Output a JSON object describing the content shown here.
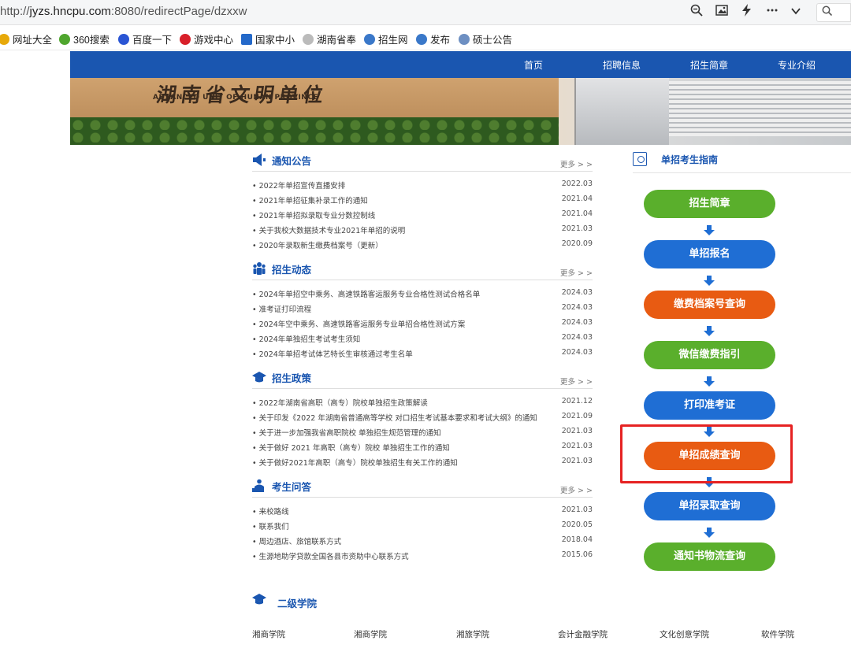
{
  "browser": {
    "url_prefix": "http://",
    "url_domain": "jyzs.hncpu.com",
    "url_rest": ":8080/redirectPage/dzxxw",
    "bookmarks": [
      "网址大全",
      "360搜索",
      "百度一下",
      "游戏中心",
      "国家中小",
      "湖南省奉",
      "招生网",
      "发布",
      "硕士公告"
    ]
  },
  "nav": [
    "首页",
    "招聘信息",
    "招生简章",
    "专业介绍"
  ],
  "banner": {
    "title": "湖南省文明单位",
    "subtitle": "ADVANCED UNIT OF HUNAN PROVINCE"
  },
  "more_label": "更多 > >",
  "sections": [
    {
      "title": "通知公告",
      "items": [
        {
          "text": "• 2022年单招宣传直播安排",
          "date": "2022.03"
        },
        {
          "text": "• 2021年单招征集补录工作的通知",
          "date": "2021.04"
        },
        {
          "text": "• 2021年单招拟录取专业分数控制线",
          "date": "2021.04"
        },
        {
          "text": "• 关于我校大数据技术专业2021年单招的说明",
          "date": "2021.03"
        },
        {
          "text": "• 2020年录取新生缴费档案号（更新）",
          "date": "2020.09"
        }
      ]
    },
    {
      "title": "招生动态",
      "items": [
        {
          "text": "• 2024年单招空中乘务、高速铁路客运服务专业合格性测试合格名单",
          "date": "2024.03"
        },
        {
          "text": "• 准考证打印流程",
          "date": "2024.03"
        },
        {
          "text": "• 2024年空中乘务、高速铁路客运服务专业单招合格性测试方案",
          "date": "2024.03"
        },
        {
          "text": "• 2024年单独招生考试考生须知",
          "date": "2024.03"
        },
        {
          "text": "• 2024年单招考试体艺特长生审核通过考生名单",
          "date": "2024.03"
        }
      ]
    },
    {
      "title": "招生政策",
      "items": [
        {
          "text": "• 2022年湖南省高职（高专）院校单独招生政策解读",
          "date": "2021.12"
        },
        {
          "text": "• 关于印发《2022 年湖南省普通高等学校 对口招生考试基本要求和考试大纲》的通知",
          "date": "2021.09"
        },
        {
          "text": "• 关于进一步加强我省高职院校 单独招生规范管理的通知",
          "date": "2021.03"
        },
        {
          "text": "• 关于做好 2021 年高职（高专）院校 单独招生工作的通知",
          "date": "2021.03"
        },
        {
          "text": "• 关于做好2021年高职（高专）院校单独招生有关工作的通知",
          "date": "2021.03"
        }
      ]
    },
    {
      "title": "考生问答",
      "items": [
        {
          "text": "• 来校路线",
          "date": "2021.03"
        },
        {
          "text": "• 联系我们",
          "date": "2020.05"
        },
        {
          "text": "• 周边酒店、旅馆联系方式",
          "date": "2018.04"
        },
        {
          "text": "• 生源地助学贷款全国各县市资助中心联系方式",
          "date": "2015.06"
        }
      ]
    }
  ],
  "guide": {
    "title": "单招考生指南",
    "buttons": [
      {
        "label": "招生简章",
        "color": "green"
      },
      {
        "label": "单招报名",
        "color": "blue"
      },
      {
        "label": "缴费档案号查询",
        "color": "orange"
      },
      {
        "label": "微信缴费指引",
        "color": "green"
      },
      {
        "label": "打印准考证",
        "color": "blue"
      },
      {
        "label": "单招成绩查询",
        "color": "orange"
      },
      {
        "label": "单招录取查询",
        "color": "blue"
      },
      {
        "label": "通知书物流查询",
        "color": "green"
      }
    ]
  },
  "colleges": {
    "title": "二级学院",
    "items": [
      "湘商学院",
      "湘商学院",
      "湘旅学院",
      "会计金融学院",
      "文化创意学院",
      "软件学院"
    ]
  },
  "colors": {
    "nav_blue": "#1a56b0",
    "green": "#5aaf2c",
    "blue": "#1f6ed4",
    "orange": "#e85b12",
    "highlight_red": "#e62222"
  }
}
